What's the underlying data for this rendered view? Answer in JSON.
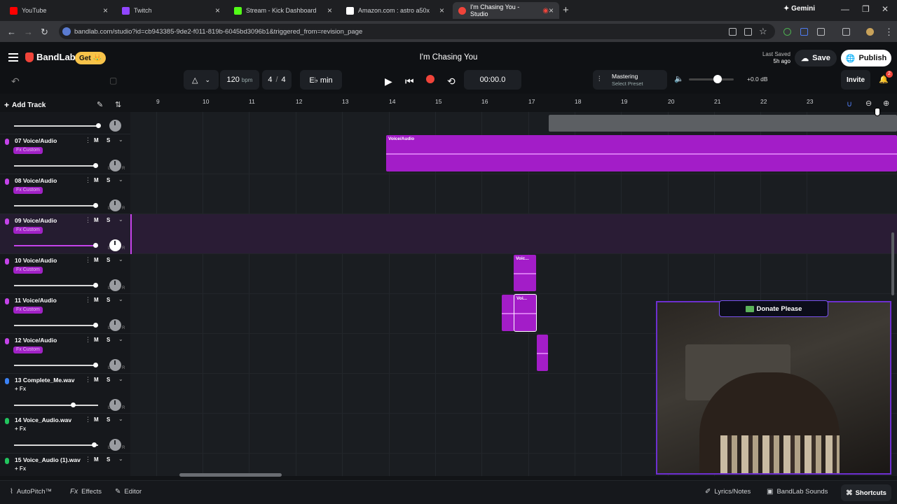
{
  "browser": {
    "tabs": [
      {
        "label": "YouTube",
        "color": "#ff0000"
      },
      {
        "label": "Twitch",
        "color": "#9146ff"
      },
      {
        "label": "Stream - Kick Dashboard",
        "color": "#53fc18"
      },
      {
        "label": "Amazon.com : astro a50x",
        "color": "#ffffff"
      },
      {
        "label": "I'm Chasing You - Studio",
        "color": "#f0443a"
      }
    ],
    "gemini_label": "Gemini",
    "url": "bandlab.com/studio?id=cb943385-9de2-f011-819b-6045bd3096b1&triggered_from=revision_page"
  },
  "header": {
    "logo": "BandLab",
    "get_label": "Get 👑",
    "project_title": "I'm Chasing You",
    "last_saved_label": "Last Saved",
    "last_saved_time": "5h ago",
    "save_label": "Save",
    "publish_label": "Publish"
  },
  "toolbar": {
    "bpm": "120",
    "bpm_unit": "bpm",
    "time_sig_num": "4",
    "time_sig_den": "4",
    "key": "E♭ min",
    "time": "00:00.0",
    "mastering_label": "Mastering",
    "mastering_preset": "Select Preset",
    "db": "+0.0 dB",
    "invite_label": "Invite",
    "notification_count": "2"
  },
  "sidebar": {
    "add_track_label": "Add Track"
  },
  "ruler": {
    "ticks": [
      "9",
      "10",
      "11",
      "12",
      "13",
      "14",
      "15",
      "16",
      "17",
      "18",
      "19",
      "20",
      "21",
      "22",
      "23"
    ]
  },
  "tracks": [
    {
      "name": "07 Voice/Audio",
      "fx": "Fx Custom",
      "color": "#c543ea",
      "volume": 0.97
    },
    {
      "name": "08 Voice/Audio",
      "fx": "Fx Custom",
      "color": "#c543ea",
      "volume": 0.97
    },
    {
      "name": "09 Voice/Audio",
      "fx": "Fx Custom",
      "color": "#c543ea",
      "volume": 0.97,
      "selected": true
    },
    {
      "name": "10 Voice/Audio",
      "fx": "Fx Custom",
      "color": "#c543ea",
      "volume": 0.97
    },
    {
      "name": "11 Voice/Audio",
      "fx": "Fx Custom",
      "color": "#c543ea",
      "volume": 0.97
    },
    {
      "name": "12 Voice/Audio",
      "fx": "Fx Custom",
      "color": "#c543ea",
      "volume": 0.97
    },
    {
      "name": "13 Complete_Me.wav",
      "fx": "+ Fx",
      "color": "#3b82f6",
      "volume": 0.7
    },
    {
      "name": "14 Voice_Audio.wav",
      "fx": "+ Fx",
      "color": "#22c55e",
      "volume": 0.95
    },
    {
      "name": "15 Voice_Audio (1).wav",
      "fx": "+ Fx",
      "color": "#22c55e",
      "volume": 0.95
    }
  ],
  "track_controls": {
    "mute": "M",
    "solo": "S"
  },
  "clips": {
    "voice_long": "Voice/Audio",
    "voice_short": "Voic...",
    "voice_tiny": "Voi..."
  },
  "overlay": {
    "donate_label": "Donate Please"
  },
  "footer": {
    "autopitch": "AutoPitch™",
    "effects": "Effects",
    "editor": "Editor",
    "lyrics": "Lyrics/Notes",
    "sounds": "BandLab Sounds",
    "shortcuts": "Shortcuts"
  }
}
